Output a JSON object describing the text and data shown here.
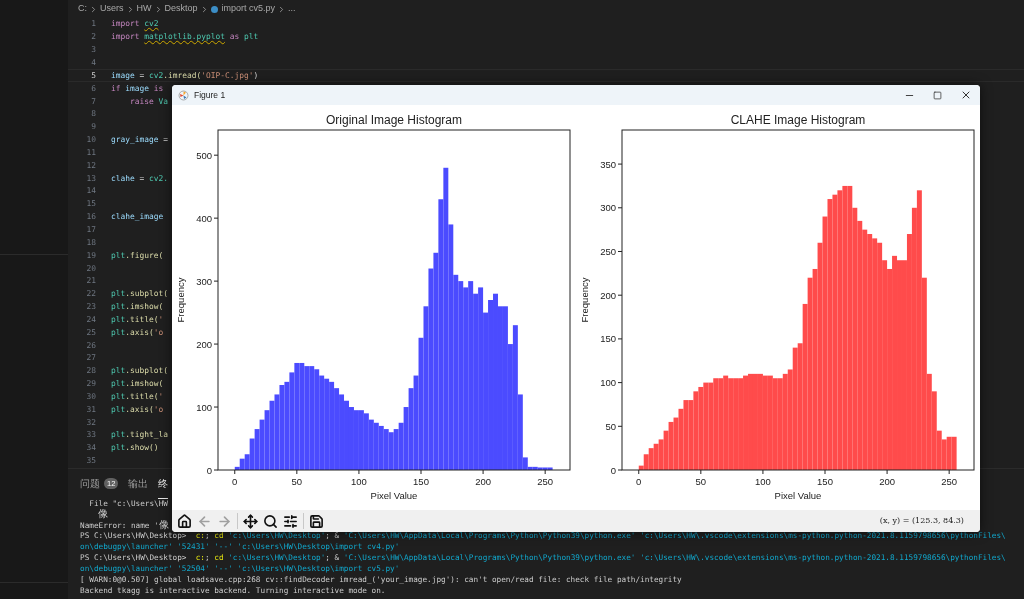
{
  "breadcrumb": [
    "C:",
    "Users",
    "HW",
    "Desktop",
    "import cv5.py",
    "..."
  ],
  "code_lines": [
    {
      "number": "1",
      "segments": [
        {
          "text": "import ",
          "kind": "keyword"
        },
        {
          "text": "cv2",
          "kind": "module_warn"
        }
      ]
    },
    {
      "number": "2",
      "segments": [
        {
          "text": "import ",
          "kind": "keyword"
        },
        {
          "text": "matplotlib.pyplot",
          "kind": "module_warn"
        },
        {
          "text": " as ",
          "kind": "keyword"
        },
        {
          "text": "plt",
          "kind": "module"
        }
      ]
    },
    {
      "number": "3"
    },
    {
      "number": "4"
    },
    {
      "number": "5",
      "active": true,
      "segments": [
        {
          "text": "image",
          "kind": "variable"
        },
        {
          "text": " = ",
          "kind": "plain"
        },
        {
          "text": "cv2",
          "kind": "module"
        },
        {
          "text": ".imread(",
          "kind": "function"
        },
        {
          "text": "'OIP-C.jpg'",
          "kind": "string"
        },
        {
          "text": ")",
          "kind": "plain"
        }
      ]
    },
    {
      "number": "6",
      "segments": [
        {
          "text": "if ",
          "kind": "keyword"
        },
        {
          "text": "image",
          "kind": "variable"
        },
        {
          "text": " is",
          "kind": "keyword"
        }
      ]
    },
    {
      "number": "7",
      "segments": [
        {
          "text": "    raise ",
          "kind": "keyword"
        },
        {
          "text": "Va",
          "kind": "module"
        }
      ]
    },
    {
      "number": "8"
    },
    {
      "number": "9"
    },
    {
      "number": "10",
      "segments": [
        {
          "text": "gray_image",
          "kind": "variable"
        },
        {
          "text": " =",
          "kind": "plain"
        }
      ]
    },
    {
      "number": "11"
    },
    {
      "number": "12"
    },
    {
      "number": "13",
      "segments": [
        {
          "text": "clahe",
          "kind": "variable"
        },
        {
          "text": " = ",
          "kind": "plain"
        },
        {
          "text": "cv2.",
          "kind": "module"
        }
      ]
    },
    {
      "number": "14"
    },
    {
      "number": "15"
    },
    {
      "number": "16",
      "segments": [
        {
          "text": "clahe_image",
          "kind": "variable"
        }
      ]
    },
    {
      "number": "17"
    },
    {
      "number": "18"
    },
    {
      "number": "19",
      "segments": [
        {
          "text": "plt",
          "kind": "module"
        },
        {
          "text": ".figure(",
          "kind": "function"
        }
      ]
    },
    {
      "number": "20"
    },
    {
      "number": "21"
    },
    {
      "number": "22",
      "segments": [
        {
          "text": "plt",
          "kind": "module"
        },
        {
          "text": ".subplot(",
          "kind": "function"
        }
      ]
    },
    {
      "number": "23",
      "segments": [
        {
          "text": "plt",
          "kind": "module"
        },
        {
          "text": ".imshow(",
          "kind": "function"
        }
      ]
    },
    {
      "number": "24",
      "segments": [
        {
          "text": "plt",
          "kind": "module"
        },
        {
          "text": ".title(",
          "kind": "function"
        },
        {
          "text": "'",
          "kind": "string"
        }
      ]
    },
    {
      "number": "25",
      "segments": [
        {
          "text": "plt",
          "kind": "module"
        },
        {
          "text": ".axis(",
          "kind": "function"
        },
        {
          "text": "'o",
          "kind": "string"
        }
      ]
    },
    {
      "number": "26"
    },
    {
      "number": "27"
    },
    {
      "number": "28",
      "segments": [
        {
          "text": "plt",
          "kind": "module"
        },
        {
          "text": ".subplot(",
          "kind": "function"
        }
      ]
    },
    {
      "number": "29",
      "segments": [
        {
          "text": "plt",
          "kind": "module"
        },
        {
          "text": ".imshow(",
          "kind": "function"
        }
      ]
    },
    {
      "number": "30",
      "segments": [
        {
          "text": "plt",
          "kind": "module"
        },
        {
          "text": ".title(",
          "kind": "function"
        },
        {
          "text": "'",
          "kind": "string"
        }
      ]
    },
    {
      "number": "31",
      "segments": [
        {
          "text": "plt",
          "kind": "module"
        },
        {
          "text": ".axis(",
          "kind": "function"
        },
        {
          "text": "'o",
          "kind": "string"
        }
      ]
    },
    {
      "number": "32"
    },
    {
      "number": "33",
      "segments": [
        {
          "text": "plt",
          "kind": "module"
        },
        {
          "text": ".tight_la",
          "kind": "function"
        }
      ]
    },
    {
      "number": "34",
      "segments": [
        {
          "text": "plt",
          "kind": "module"
        },
        {
          "text": ".show()",
          "kind": "function"
        }
      ]
    },
    {
      "number": "35"
    }
  ],
  "panel_tabs": [
    {
      "label": "问题",
      "badge": "12",
      "selected": false
    },
    {
      "label": "输出",
      "selected": false
    },
    {
      "label": "终",
      "selected": true
    }
  ],
  "terminal_lines": [
    [
      {
        "text": "  File \"c:\\Users\\HW",
        "kind": "plain"
      }
    ],
    [
      {
        "text": "   像",
        "kind": "cjk"
      }
    ],
    [
      {
        "text": "NameError: name '",
        "kind": "plain"
      },
      {
        "text": "像",
        "kind": "cjk"
      }
    ],
    [
      {
        "text": "PS C:\\Users\\HW\\Desktop>  ",
        "kind": "plain"
      },
      {
        "text": "c:",
        "kind": "command"
      },
      {
        "text": "; ",
        "kind": "plain"
      },
      {
        "text": "cd",
        "kind": "command"
      },
      {
        "text": " 'c:\\Users\\HW\\Desktop'",
        "kind": "string"
      },
      {
        "text": "; & ",
        "kind": "plain"
      },
      {
        "text": "'C:\\Users\\HW\\AppData\\Local\\Programs\\Python\\Python39\\python.exe' 'c:\\Users\\HW\\.vscode\\extensions\\ms-python.python-2021.8.1159798656\\pythonFiles\\",
        "kind": "string"
      }
    ],
    [
      {
        "text": "on\\debugpy\\launcher' '52431' '--' 'c:\\Users\\HW\\Desktop\\import cv4.py'",
        "kind": "string"
      }
    ],
    [
      {
        "text": "PS C:\\Users\\HW\\Desktop>  ",
        "kind": "plain"
      },
      {
        "text": "c:",
        "kind": "command"
      },
      {
        "text": "; ",
        "kind": "plain"
      },
      {
        "text": "cd",
        "kind": "command"
      },
      {
        "text": " 'c:\\Users\\HW\\Desktop'",
        "kind": "string"
      },
      {
        "text": "; & ",
        "kind": "plain"
      },
      {
        "text": "'C:\\Users\\HW\\AppData\\Local\\Programs\\Python\\Python39\\python.exe' 'c:\\Users\\HW\\.vscode\\extensions\\ms-python.python-2021.8.1159798656\\pythonFiles\\",
        "kind": "string"
      }
    ],
    [
      {
        "text": "on\\debugpy\\launcher' '52504' '--' 'c:\\Users\\HW\\Desktop\\import cv5.py'",
        "kind": "string"
      }
    ],
    [
      {
        "text": "[ WARN:0@0.507] global loadsave.cpp:268 cv::findDecoder imread_('your_image.jpg'): can't open/read file: check file path/integrity",
        "kind": "plain"
      }
    ],
    [
      {
        "text": "Backend tkagg is interactive backend. Turning interactive mode on.",
        "kind": "plain"
      }
    ]
  ],
  "figure_window": {
    "title": "Figure 1",
    "charts": [
      {
        "chart_data": {
          "type": "bar",
          "title": "Original Image Histogram",
          "xlabel": "Pixel Value",
          "ylabel": "Frequency",
          "x": [
            0,
            4,
            8,
            12,
            16,
            20,
            24,
            28,
            32,
            36,
            40,
            44,
            48,
            52,
            56,
            60,
            64,
            68,
            72,
            76,
            80,
            84,
            88,
            92,
            96,
            100,
            104,
            108,
            112,
            116,
            120,
            124,
            128,
            132,
            136,
            140,
            144,
            148,
            152,
            156,
            160,
            164,
            168,
            172,
            176,
            180,
            184,
            188,
            192,
            196,
            200,
            204,
            208,
            212,
            216,
            220,
            224,
            228,
            232,
            236,
            240,
            244,
            248,
            252
          ],
          "series": [
            {
              "color": "#4b4bff",
              "values": [
                5,
                18,
                25,
                50,
                65,
                80,
                95,
                110,
                120,
                135,
                140,
                155,
                170,
                170,
                165,
                165,
                160,
                150,
                145,
                140,
                130,
                120,
                110,
                100,
                95,
                95,
                90,
                80,
                75,
                70,
                65,
                60,
                65,
                75,
                100,
                130,
                150,
                210,
                260,
                320,
                345,
                430,
                480,
                390,
                310,
                300,
                290,
                300,
                280,
                290,
                250,
                270,
                280,
                260,
                260,
                200,
                230,
                120,
                20,
                5,
                5,
                4,
                4,
                4
              ]
            }
          ],
          "xlim": [
            -13.5,
            270
          ],
          "ylim": [
            0,
            540
          ],
          "xticks": [
            0,
            50,
            100,
            150,
            200,
            250
          ],
          "yticks": [
            0,
            100,
            200,
            300,
            400,
            500
          ]
        }
      },
      {
        "chart_data": {
          "type": "bar",
          "title": "CLAHE Image Histogram",
          "xlabel": "Pixel Value",
          "ylabel": "Frequency",
          "x": [
            0,
            4,
            8,
            12,
            16,
            20,
            24,
            28,
            32,
            36,
            40,
            44,
            48,
            52,
            56,
            60,
            64,
            68,
            72,
            76,
            80,
            84,
            88,
            92,
            96,
            100,
            104,
            108,
            112,
            116,
            120,
            124,
            128,
            132,
            136,
            140,
            144,
            148,
            152,
            156,
            160,
            164,
            168,
            172,
            176,
            180,
            184,
            188,
            192,
            196,
            200,
            204,
            208,
            212,
            216,
            220,
            224,
            228,
            232,
            236,
            240,
            244,
            248,
            252
          ],
          "series": [
            {
              "color": "#ff4b4b",
              "values": [
                5,
                18,
                25,
                30,
                35,
                45,
                55,
                60,
                70,
                80,
                80,
                90,
                95,
                100,
                100,
                105,
                105,
                108,
                105,
                105,
                105,
                108,
                110,
                110,
                110,
                108,
                108,
                105,
                105,
                110,
                115,
                140,
                145,
                190,
                220,
                230,
                260,
                290,
                310,
                315,
                320,
                325,
                325,
                300,
                285,
                275,
                270,
                265,
                260,
                240,
                230,
                245,
                240,
                240,
                270,
                300,
                320,
                220,
                110,
                90,
                45,
                35,
                38,
                38
              ]
            }
          ],
          "xlim": [
            -13.5,
            270
          ],
          "ylim": [
            0,
            389
          ],
          "xticks": [
            0,
            50,
            100,
            150,
            200,
            250
          ],
          "yticks": [
            0,
            50,
            100,
            150,
            200,
            250,
            300,
            350
          ]
        }
      }
    ],
    "toolbar": [
      {
        "kind": "home",
        "disabled": false
      },
      {
        "kind": "back",
        "disabled": true
      },
      {
        "kind": "forward",
        "disabled": true
      },
      {
        "kind": "pan",
        "disabled": false
      },
      {
        "kind": "zoom",
        "disabled": false
      },
      {
        "kind": "configure",
        "disabled": false
      },
      {
        "kind": "save",
        "disabled": false
      }
    ],
    "coordinates": "(x, y) = (125.3, 84.3)"
  }
}
